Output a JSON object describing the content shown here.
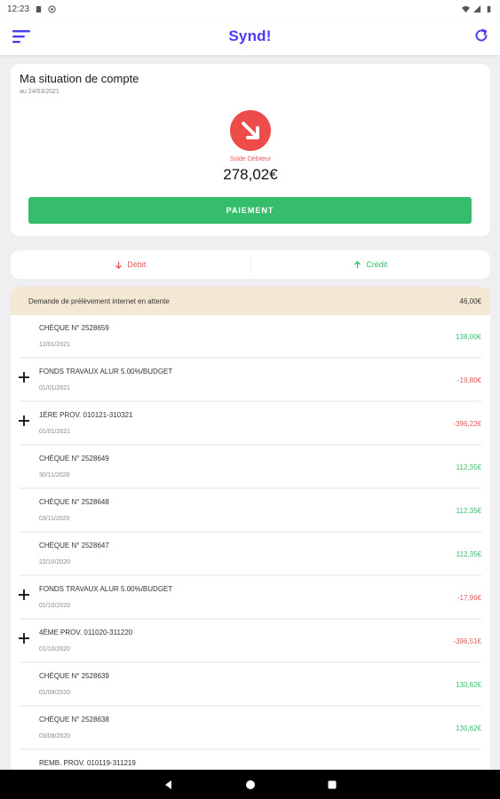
{
  "status_bar": {
    "time": "12:23"
  },
  "header": {
    "title": "Synd!"
  },
  "account": {
    "title": "Ma situation de compte",
    "date": "au 24/03/2021",
    "balance_label": "Solde Débiteur",
    "balance_amount": "278,02€",
    "pay_button": "PAIEMENT"
  },
  "filters": {
    "debit": "Débit",
    "credit": "Crédit"
  },
  "pending": {
    "label": "Demande de prélèvement internet en attente",
    "amount": "46,00€"
  },
  "transactions": [
    {
      "label": "CHÈQUE N° 2528659",
      "date": "12/01/2021",
      "amount": "138,00€",
      "type": "credit",
      "expandable": false
    },
    {
      "label": "FONDS TRAVAUX ALUR 5.00%/BUDGET",
      "date": "01/01/2021",
      "amount": "-19,80€",
      "type": "debit",
      "expandable": true
    },
    {
      "label": "1ÈRE PROV. 010121-310321",
      "date": "01/01/2021",
      "amount": "-396,22€",
      "type": "debit",
      "expandable": true
    },
    {
      "label": "CHÈQUE N° 2528649",
      "date": "30/11/2020",
      "amount": "112,35€",
      "type": "credit",
      "expandable": false
    },
    {
      "label": "CHÈQUE N° 2528648",
      "date": "03/11/2020",
      "amount": "112,35€",
      "type": "credit",
      "expandable": false
    },
    {
      "label": "CHÈQUE N° 2528647",
      "date": "22/10/2020",
      "amount": "112,35€",
      "type": "credit",
      "expandable": false
    },
    {
      "label": "FONDS TRAVAUX ALUR 5.00%/BUDGET",
      "date": "01/10/2020",
      "amount": "-17,96€",
      "type": "debit",
      "expandable": true
    },
    {
      "label": "4ÈME PROV. 011020-311220",
      "date": "01/10/2020",
      "amount": "-396,51€",
      "type": "debit",
      "expandable": true
    },
    {
      "label": "CHÈQUE N° 2528639",
      "date": "01/09/2020",
      "amount": "130,62€",
      "type": "credit",
      "expandable": false
    },
    {
      "label": "CHÈQUE N° 2528638",
      "date": "03/08/2020",
      "amount": "130,62€",
      "type": "credit",
      "expandable": false
    },
    {
      "label": "REMB. PROV. 010119-311219",
      "date": "",
      "amount": "",
      "type": "credit",
      "expandable": false
    }
  ],
  "colors": {
    "brand": "#4a3df0",
    "credit": "#36bd6c",
    "debit": "#e05a5a",
    "pending_bg": "#f4e8d4"
  },
  "icons": {
    "menu": "menu-icon",
    "refresh": "refresh-icon",
    "balance": "arrow-down-right-icon",
    "debit": "arrow-down-icon",
    "credit": "arrow-up-icon",
    "expand": "plus-icon"
  }
}
